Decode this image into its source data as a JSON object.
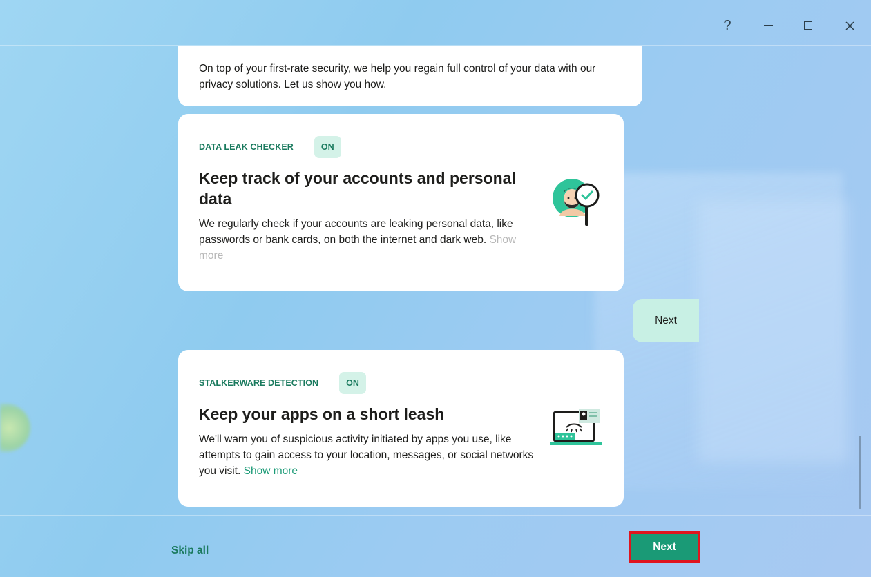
{
  "window": {
    "help_glyph": "?",
    "controls": [
      "help",
      "minimize",
      "maximize",
      "close"
    ]
  },
  "intro": {
    "text": "On top of your first-rate security, we help you regain full control of your data with our privacy solutions. Let us show you how."
  },
  "cards": [
    {
      "feature": "DATA LEAK CHECKER",
      "status": "ON",
      "title": "Keep track of your accounts and personal data",
      "description": "We regularly check if your accounts are leaking personal data, like passwords or bank cards, on both the internet and dark web.",
      "show_more": "Show more",
      "icon": "person-magnifier-icon"
    },
    {
      "feature": "STALKERWARE DETECTION",
      "status": "ON",
      "title": "Keep your apps on a short leash",
      "description": "We'll warn you of suspicious activity initiated by apps you use, like attempts to gain access to your location, messages, or social networks you visit.",
      "show_more": "Show more",
      "icon": "laptop-eye-icon"
    }
  ],
  "reply": {
    "text": "Next"
  },
  "footer": {
    "skip_label": "Skip all",
    "next_label": "Next"
  },
  "colors": {
    "accent": "#1a9a76",
    "accent_dark": "#1a7a5e",
    "badge_bg": "#d4f2e8",
    "reply_bg": "#c8f0e4",
    "highlight_border": "#e0141e"
  }
}
